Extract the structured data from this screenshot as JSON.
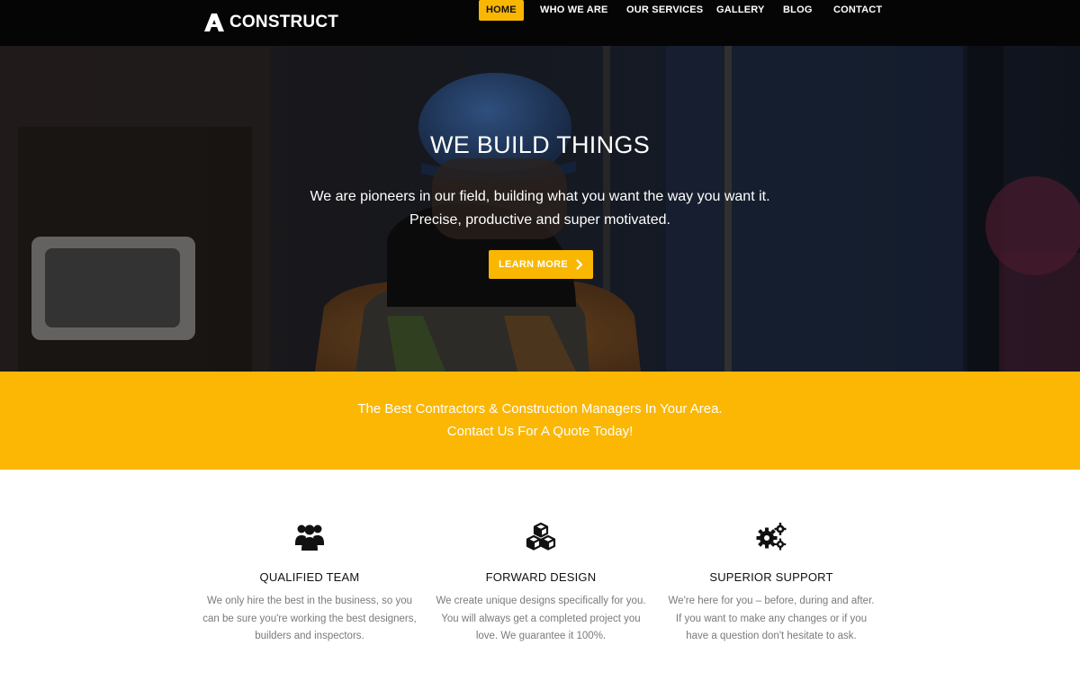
{
  "brand": {
    "name": "CONSTRUCT",
    "logo_icon": "a-logo-icon"
  },
  "nav": {
    "items": [
      {
        "label": "HOME",
        "active": true
      },
      {
        "label": "WHO WE ARE",
        "active": false
      },
      {
        "label": "OUR SERVICES",
        "active": false
      },
      {
        "label": "GALLERY",
        "active": false
      },
      {
        "label": "BLOG",
        "active": false
      },
      {
        "label": "CONTACT",
        "active": false
      }
    ]
  },
  "hero": {
    "title": "WE BUILD THINGS",
    "subtitle_line1": "We are pioneers in our field, building what you want the way you want it.",
    "subtitle_line2": "Precise, productive and super motivated.",
    "cta_label": "LEARN MORE",
    "cta_icon": "chevron-right-icon"
  },
  "banner": {
    "line1": "The Best Contractors & Construction Managers In Your Area.",
    "line2": "Contact Us For A Quote Today!"
  },
  "features": [
    {
      "icon": "team-icon",
      "title": "QUALIFIED TEAM",
      "desc": "We only hire the best in the business, so you can be sure you're working the best designers, builders and inspectors."
    },
    {
      "icon": "cubes-icon",
      "title": "FORWARD DESIGN",
      "desc": "We create unique designs specifically for you. You will always get a completed project you love. We guarantee it 100%."
    },
    {
      "icon": "gears-icon",
      "title": "SUPERIOR SUPPORT",
      "desc": "We're here for you – before, during and after. If you want to make any changes or if you have a question don't hesitate to ask."
    }
  ],
  "colors": {
    "accent": "#f9b701",
    "navbar": "#050505",
    "text_muted": "#7a7a7a"
  }
}
